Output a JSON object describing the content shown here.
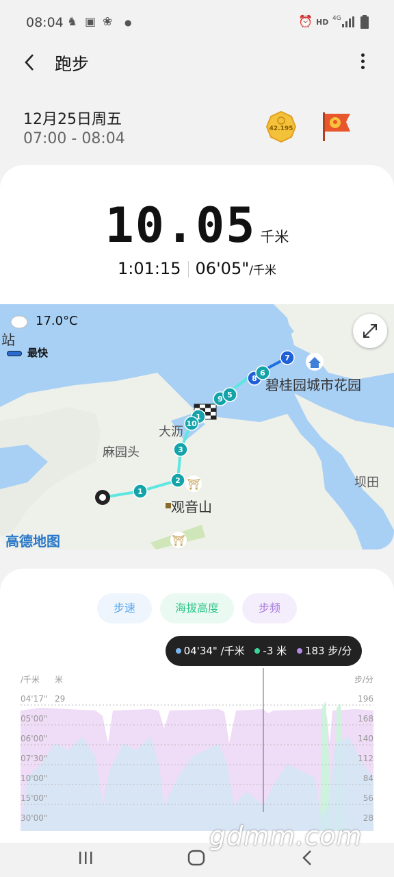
{
  "status": {
    "time": "08:04",
    "hd": "HD",
    "net": "4G"
  },
  "header": {
    "title": "跑步"
  },
  "session": {
    "date": "12月25日周五",
    "time_range": "07:00 - 08:04",
    "badge_text": "42.195"
  },
  "summary": {
    "distance": "10.05",
    "distance_unit": "千米",
    "duration": "1:01:15",
    "pace": "06'05\"",
    "pace_unit": "/千米"
  },
  "map": {
    "temperature": "17.0°C",
    "station": "站",
    "legend_fast": "最快",
    "labels": {
      "place1": "碧桂园城市花园",
      "place2": "麻园头",
      "place3": "大沥",
      "place4": "观音山",
      "place5": "坝田"
    },
    "provider": "高德地图",
    "markers": [
      "1",
      "2",
      "3",
      "1",
      "10",
      "9",
      "5",
      "8",
      "6",
      "7"
    ]
  },
  "chart": {
    "tabs": [
      {
        "label": "步速"
      },
      {
        "label": "海拔高度"
      },
      {
        "label": "步频"
      }
    ],
    "tooltip": {
      "pace": "04'34\" /千米",
      "altitude": "-3 米",
      "cadence": "183 步/分"
    },
    "left_units": {
      "pace": "/千米",
      "altitude": "米"
    },
    "right_unit": "步/分",
    "pace_ticks": [
      "04'17\"",
      "05'00\"",
      "06'00\"",
      "07'30\"",
      "10'00\"",
      "15'00\"",
      "30'00\""
    ],
    "altitude_ticks": [
      "29"
    ],
    "cadence_ticks": [
      "196",
      "168",
      "140",
      "112",
      "84",
      "56",
      "28"
    ],
    "colors": {
      "pace": "#7bb6ef",
      "altitude": "#3dd69a",
      "cadence": "#b68be6"
    }
  },
  "watermark": "gdmm.com"
}
